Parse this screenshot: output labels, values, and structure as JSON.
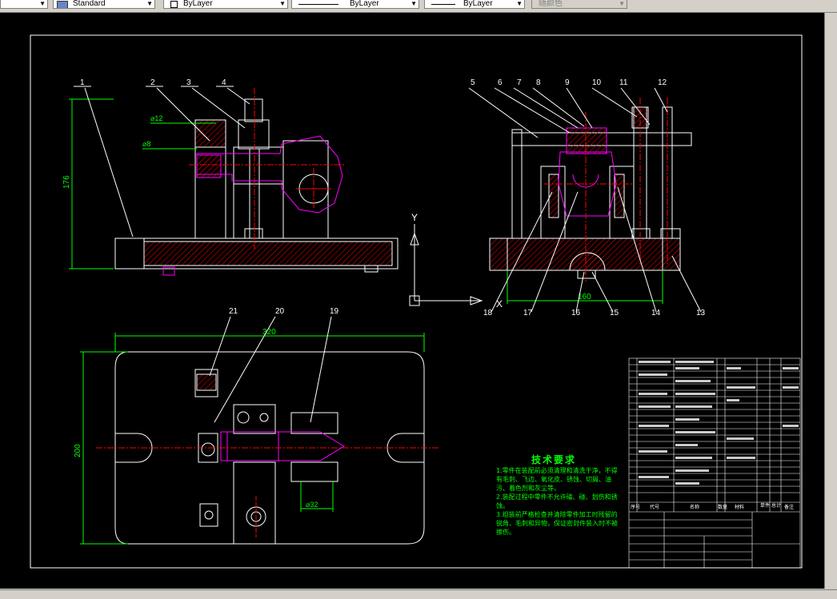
{
  "toolbar": {
    "text_style": "Standard",
    "layer": "ByLayer",
    "linetype": "ByLayer",
    "lineweight": "ByLayer",
    "plot_style": "随颜色"
  },
  "drawing": {
    "front_view_balloons": [
      "1",
      "2",
      "3",
      "4"
    ],
    "side_view_balloons_top": [
      "5",
      "6",
      "7",
      "8",
      "9",
      "10",
      "11",
      "12"
    ],
    "side_view_balloons_bottom": [
      "18",
      "17",
      "16",
      "15",
      "14",
      "13"
    ],
    "top_view_balloons": [
      "21",
      "20",
      "19"
    ],
    "dim_176": "176",
    "dim_160": "160",
    "dim_320": "320",
    "dim_200": "200",
    "dim_phi12": "⌀12",
    "dim_phi8": "⌀8",
    "dim_phi32": "⌀32",
    "axis_y": "Y",
    "axis_x": "X"
  },
  "tech_requirements": {
    "title": "技术要求",
    "lines": [
      "1.零件在装配前必须清理和清洗干净，不得有毛刺、飞边、氧化皮、锈蚀、切屑、油污、着色剂和灰尘等。",
      "2.装配过程中零件不允许磕、碰、划伤和锈蚀。",
      "3.组装前严格检查并清除零件加工时残留的锐角、毛刺和异物，保证密封件装入时不被擦伤。"
    ]
  },
  "title_block": {
    "headers": [
      "序号",
      "代号",
      "名称",
      "数量",
      "材料",
      "单件",
      "总计",
      "备注"
    ]
  },
  "colors": {
    "canvas": "#000000",
    "outline": "#ffffff",
    "hatch": "#ff0000",
    "dimension": "#00ff00",
    "highlight": "#ff00ff",
    "centerline": "#ff0000"
  }
}
